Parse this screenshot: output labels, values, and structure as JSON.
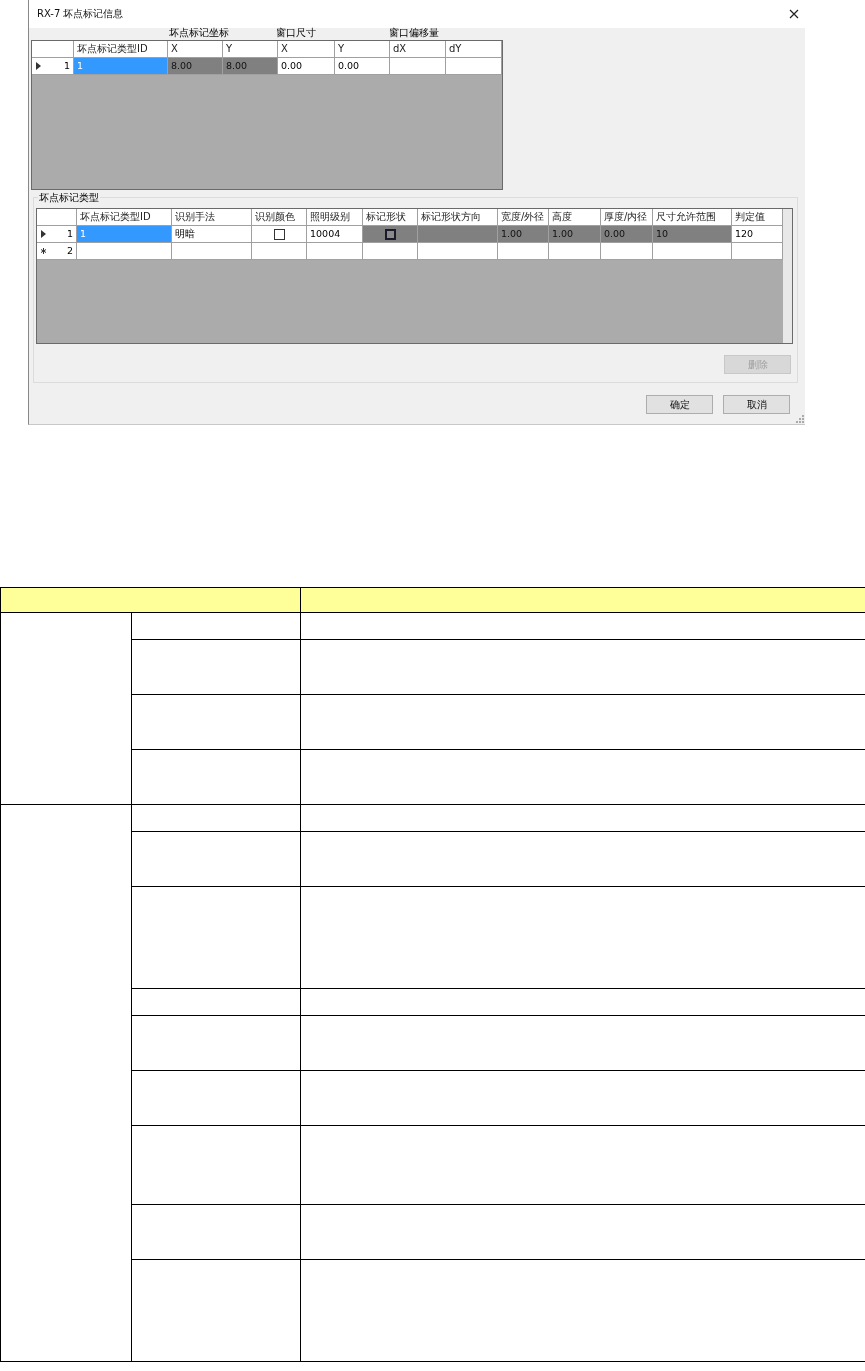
{
  "dialog": {
    "title": "RX-7 坏点标记信息"
  },
  "marker_grid": {
    "column_groups": [
      "坏点标记坐标",
      "窗口尺寸",
      "窗口偏移量"
    ],
    "columns": [
      "坏点标记类型ID",
      "X",
      "Y",
      "X",
      "Y",
      "dX",
      "dY"
    ],
    "rows": [
      {
        "number": "1",
        "current": true,
        "new_row": false,
        "cells": [
          {
            "kind": "text",
            "text": "1",
            "selected": true,
            "readonly": false
          },
          {
            "kind": "text",
            "text": "8.00",
            "selected": false,
            "readonly": true
          },
          {
            "kind": "text",
            "text": "8.00",
            "selected": false,
            "readonly": true
          },
          {
            "kind": "text",
            "text": "0.00",
            "selected": false,
            "readonly": false
          },
          {
            "kind": "text",
            "text": "0.00",
            "selected": false,
            "readonly": false
          },
          {
            "kind": "text",
            "selected": false,
            "readonly": false
          },
          {
            "kind": "text",
            "selected": false,
            "readonly": false
          }
        ]
      }
    ]
  },
  "type_group": {
    "title": "坏点标记类型",
    "grid": {
      "columns": [
        "坏点标记类型ID",
        "识别手法",
        "识别颜色",
        "照明级别",
        "标记形状",
        "标记形状方向",
        "宽度/外径",
        "高度",
        "厚度/内径",
        "尺寸允许范围",
        "判定值"
      ],
      "rows": [
        {
          "number": "1",
          "current": true,
          "new_row": false,
          "cells": [
            {
              "kind": "text",
              "text": "1",
              "selected": true,
              "readonly": false
            },
            {
              "kind": "text",
              "text": "明暗",
              "selected": false,
              "readonly": false
            },
            {
              "kind": "checkbox",
              "checked": false,
              "selected": false,
              "readonly": false
            },
            {
              "kind": "text",
              "text": "10004",
              "selected": false,
              "readonly": false
            },
            {
              "kind": "swatch",
              "selected": false,
              "readonly": true
            },
            {
              "kind": "text",
              "selected": false,
              "readonly": true
            },
            {
              "kind": "text",
              "text": "1.00",
              "selected": false,
              "readonly": true
            },
            {
              "kind": "text",
              "text": "1.00",
              "selected": false,
              "readonly": true
            },
            {
              "kind": "text",
              "text": "0.00",
              "selected": false,
              "readonly": true
            },
            {
              "kind": "text",
              "text": "10",
              "selected": false,
              "readonly": true
            },
            {
              "kind": "text",
              "text": "120",
              "selected": false,
              "readonly": false
            }
          ]
        },
        {
          "number": "2",
          "current": false,
          "new_row": true,
          "cells": [
            {
              "kind": "text",
              "selected": false,
              "readonly": false
            },
            {
              "kind": "text",
              "selected": false,
              "readonly": false
            },
            {
              "kind": "text",
              "selected": false,
              "readonly": false
            },
            {
              "kind": "text",
              "selected": false,
              "readonly": false
            },
            {
              "kind": "text",
              "selected": false,
              "readonly": false
            },
            {
              "kind": "text",
              "selected": false,
              "readonly": false
            },
            {
              "kind": "text",
              "selected": false,
              "readonly": false
            },
            {
              "kind": "text",
              "selected": false,
              "readonly": false
            },
            {
              "kind": "text",
              "selected": false,
              "readonly": false
            },
            {
              "kind": "text",
              "selected": false,
              "readonly": false
            },
            {
              "kind": "text",
              "selected": false,
              "readonly": false
            }
          ]
        }
      ]
    }
  },
  "buttons": [
    {
      "label": "删除",
      "disabled": true,
      "kind": "group"
    },
    {
      "label": "确定",
      "disabled": false,
      "kind": "footer"
    },
    {
      "label": "取消",
      "disabled": false,
      "kind": "footer"
    }
  ],
  "spec_table": {
    "groups": [
      {
        "rows": [
          {
            "kind": "single"
          },
          {
            "kind": "double"
          },
          {
            "kind": "double"
          },
          {
            "kind": "double"
          }
        ]
      },
      {
        "rows": [
          {
            "kind": "single"
          },
          {
            "kind": "double"
          },
          {
            "kind": "quad"
          },
          {
            "kind": "single"
          },
          {
            "kind": "double"
          },
          {
            "kind": "double"
          },
          {
            "kind": "triple"
          },
          {
            "kind": "double"
          },
          {
            "kind": "quad"
          }
        ]
      }
    ]
  }
}
